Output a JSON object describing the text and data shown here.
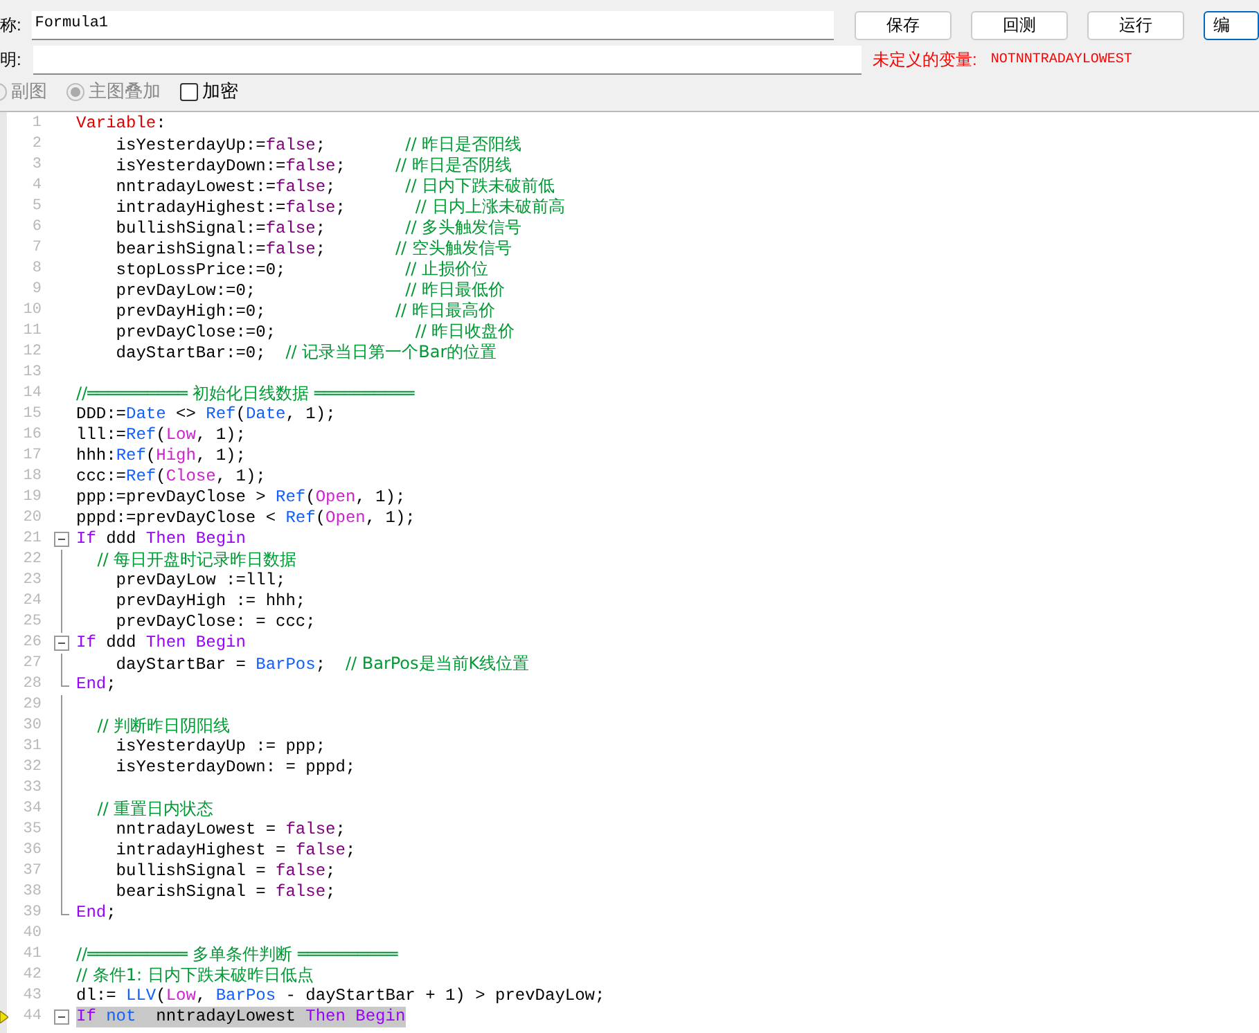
{
  "form": {
    "name_label": "称:",
    "name_value": "Formula1",
    "desc_label": "明:",
    "buttons": [
      "保存",
      "回测",
      "运行",
      "编"
    ],
    "error_label": "未定义的变量:",
    "error_value": "NOTNNTRADAYLOWEST",
    "options": [
      {
        "kind": "radio",
        "label": "副图",
        "selected": false,
        "disabled": true
      },
      {
        "kind": "radio",
        "label": "主图叠加",
        "selected": true,
        "disabled": true
      },
      {
        "kind": "checkbox",
        "label": "加密",
        "checked": false,
        "disabled": false
      }
    ]
  },
  "editor": {
    "lines": [
      {
        "number": "1",
        "kind": "plain",
        "highlighted": false,
        "segments": [
          {
            "kind": "declare",
            "text": "Variable"
          },
          {
            "kind": "plain",
            "text": ":"
          }
        ]
      },
      {
        "number": "2",
        "kind": "plain",
        "highlighted": false,
        "segments": [
          {
            "kind": "plain",
            "text": "    isYesterdayUp:="
          },
          {
            "kind": "bool",
            "text": "false"
          },
          {
            "kind": "plain",
            "text": ";        "
          },
          {
            "kind": "comment",
            "text": "// 昨日是否阳线"
          }
        ]
      },
      {
        "number": "3",
        "kind": "plain",
        "highlighted": false,
        "segments": [
          {
            "kind": "plain",
            "text": "    isYesterdayDown:="
          },
          {
            "kind": "bool",
            "text": "false"
          },
          {
            "kind": "plain",
            "text": ";     "
          },
          {
            "kind": "comment",
            "text": "// 昨日是否阴线"
          }
        ]
      },
      {
        "number": "4",
        "kind": "plain",
        "highlighted": false,
        "segments": [
          {
            "kind": "plain",
            "text": "    nntradayLowest:="
          },
          {
            "kind": "bool",
            "text": "false"
          },
          {
            "kind": "plain",
            "text": ";       "
          },
          {
            "kind": "comment",
            "text": "// 日内下跌未破前低"
          }
        ]
      },
      {
        "number": "5",
        "kind": "plain",
        "highlighted": false,
        "segments": [
          {
            "kind": "plain",
            "text": "    intradayHighest:="
          },
          {
            "kind": "bool",
            "text": "false"
          },
          {
            "kind": "plain",
            "text": ";       "
          },
          {
            "kind": "comment",
            "text": "// 日内上涨未破前高"
          }
        ]
      },
      {
        "number": "6",
        "kind": "plain",
        "highlighted": false,
        "segments": [
          {
            "kind": "plain",
            "text": "    bullishSignal:="
          },
          {
            "kind": "bool",
            "text": "false"
          },
          {
            "kind": "plain",
            "text": ";        "
          },
          {
            "kind": "comment",
            "text": "// 多头触发信号"
          }
        ]
      },
      {
        "number": "7",
        "kind": "plain",
        "highlighted": false,
        "segments": [
          {
            "kind": "plain",
            "text": "    bearishSignal:="
          },
          {
            "kind": "bool",
            "text": "false"
          },
          {
            "kind": "plain",
            "text": ";       "
          },
          {
            "kind": "comment",
            "text": "// 空头触发信号"
          }
        ]
      },
      {
        "number": "8",
        "kind": "plain",
        "highlighted": false,
        "segments": [
          {
            "kind": "plain",
            "text": "    stopLossPrice:=0;            "
          },
          {
            "kind": "comment",
            "text": "// 止损价位"
          }
        ]
      },
      {
        "number": "9",
        "kind": "plain",
        "highlighted": false,
        "segments": [
          {
            "kind": "plain",
            "text": "    prevDayLow:=0;               "
          },
          {
            "kind": "comment",
            "text": "// 昨日最低价"
          }
        ]
      },
      {
        "number": "10",
        "kind": "plain",
        "highlighted": false,
        "segments": [
          {
            "kind": "plain",
            "text": "    prevDayHigh:=0;             "
          },
          {
            "kind": "comment",
            "text": "// 昨日最高价"
          }
        ]
      },
      {
        "number": "11",
        "kind": "plain",
        "highlighted": false,
        "segments": [
          {
            "kind": "plain",
            "text": "    prevDayClose:=0;              "
          },
          {
            "kind": "comment",
            "text": "// 昨日收盘价"
          }
        ]
      },
      {
        "number": "12",
        "kind": "plain",
        "highlighted": false,
        "segments": [
          {
            "kind": "plain",
            "text": "    dayStartBar:=0;  "
          },
          {
            "kind": "comment",
            "text": "// 记录当日第一个Bar的位置"
          }
        ]
      },
      {
        "number": "13",
        "kind": "plain",
        "highlighted": false
      },
      {
        "number": "14",
        "kind": "plain",
        "highlighted": false,
        "segments": [
          {
            "kind": "comment",
            "text": "//══════════ 初始化日线数据 ══════════"
          }
        ]
      },
      {
        "number": "15",
        "kind": "plain",
        "highlighted": false,
        "segments": [
          {
            "kind": "plain",
            "text": "DDD:="
          },
          {
            "kind": "func",
            "text": "Date"
          },
          {
            "kind": "plain",
            "text": " <> "
          },
          {
            "kind": "func",
            "text": "Ref"
          },
          {
            "kind": "plain",
            "text": "("
          },
          {
            "kind": "func",
            "text": "Date"
          },
          {
            "kind": "plain",
            "text": ", 1);"
          }
        ]
      },
      {
        "number": "16",
        "kind": "plain",
        "highlighted": false,
        "segments": [
          {
            "kind": "plain",
            "text": "lll:="
          },
          {
            "kind": "func",
            "text": "Ref"
          },
          {
            "kind": "plain",
            "text": "("
          },
          {
            "kind": "series",
            "text": "Low"
          },
          {
            "kind": "plain",
            "text": ", 1);"
          }
        ]
      },
      {
        "number": "17",
        "kind": "plain",
        "highlighted": false,
        "segments": [
          {
            "kind": "plain",
            "text": "hhh:"
          },
          {
            "kind": "func",
            "text": "Ref"
          },
          {
            "kind": "plain",
            "text": "("
          },
          {
            "kind": "series",
            "text": "High"
          },
          {
            "kind": "plain",
            "text": ", 1);"
          }
        ]
      },
      {
        "number": "18",
        "kind": "plain",
        "highlighted": false,
        "segments": [
          {
            "kind": "plain",
            "text": "ccc:="
          },
          {
            "kind": "func",
            "text": "Ref"
          },
          {
            "kind": "plain",
            "text": "("
          },
          {
            "kind": "series",
            "text": "Close"
          },
          {
            "kind": "plain",
            "text": ", 1);"
          }
        ]
      },
      {
        "number": "19",
        "kind": "plain",
        "highlighted": false,
        "segments": [
          {
            "kind": "plain",
            "text": "ppp:=prevDayClose > "
          },
          {
            "kind": "func",
            "text": "Ref"
          },
          {
            "kind": "plain",
            "text": "("
          },
          {
            "kind": "series",
            "text": "Open"
          },
          {
            "kind": "plain",
            "text": ", 1);"
          }
        ]
      },
      {
        "number": "20",
        "kind": "plain",
        "highlighted": false,
        "segments": [
          {
            "kind": "plain",
            "text": "pppd:=prevDayClose < "
          },
          {
            "kind": "func",
            "text": "Ref"
          },
          {
            "kind": "plain",
            "text": "("
          },
          {
            "kind": "series",
            "text": "Open"
          },
          {
            "kind": "plain",
            "text": ", 1);"
          }
        ]
      },
      {
        "number": "21",
        "kind": "open",
        "highlighted": false,
        "segments": [
          {
            "kind": "control",
            "text": "If"
          },
          {
            "kind": "plain",
            "text": " ddd "
          },
          {
            "kind": "control",
            "text": "Then Begin"
          }
        ]
      },
      {
        "number": "22",
        "kind": "body",
        "highlighted": false,
        "segments": [
          {
            "kind": "comment",
            "text": "    // 每日开盘时记录昨日数据"
          }
        ]
      },
      {
        "number": "23",
        "kind": "body",
        "highlighted": false,
        "segments": [
          {
            "kind": "plain",
            "text": "    prevDayLow :=lll;"
          }
        ]
      },
      {
        "number": "24",
        "kind": "body",
        "highlighted": false,
        "segments": [
          {
            "kind": "plain",
            "text": "    prevDayHigh := hhh;"
          }
        ]
      },
      {
        "number": "25",
        "kind": "body",
        "highlighted": false,
        "segments": [
          {
            "kind": "plain",
            "text": "    prevDayClose: = ccc;"
          }
        ]
      },
      {
        "number": "26",
        "kind": "open",
        "highlighted": false,
        "segments": [
          {
            "kind": "control",
            "text": "If"
          },
          {
            "kind": "plain",
            "text": " ddd "
          },
          {
            "kind": "control",
            "text": "Then Begin"
          }
        ]
      },
      {
        "number": "27",
        "kind": "body",
        "highlighted": false,
        "segments": [
          {
            "kind": "plain",
            "text": "    dayStartBar = "
          },
          {
            "kind": "func",
            "text": "BarPos"
          },
          {
            "kind": "plain",
            "text": ";  "
          },
          {
            "kind": "comment",
            "text": "// BarPos是当前K线位置"
          }
        ]
      },
      {
        "number": "28",
        "kind": "close",
        "highlighted": false,
        "segments": [
          {
            "kind": "control",
            "text": "End"
          },
          {
            "kind": "plain",
            "text": ";"
          }
        ]
      },
      {
        "number": "29",
        "kind": "body",
        "highlighted": false
      },
      {
        "number": "30",
        "kind": "body",
        "highlighted": false,
        "segments": [
          {
            "kind": "comment",
            "text": "    // 判断昨日阴阳线"
          }
        ]
      },
      {
        "number": "31",
        "kind": "body",
        "highlighted": false,
        "segments": [
          {
            "kind": "plain",
            "text": "    isYesterdayUp := ppp;"
          }
        ]
      },
      {
        "number": "32",
        "kind": "body",
        "highlighted": false,
        "segments": [
          {
            "kind": "plain",
            "text": "    isYesterdayDown: = pppd;"
          }
        ]
      },
      {
        "number": "33",
        "kind": "body",
        "highlighted": false
      },
      {
        "number": "34",
        "kind": "body",
        "highlighted": false,
        "segments": [
          {
            "kind": "comment",
            "text": "    // 重置日内状态"
          }
        ]
      },
      {
        "number": "35",
        "kind": "body",
        "highlighted": false,
        "segments": [
          {
            "kind": "plain",
            "text": "    nntradayLowest = "
          },
          {
            "kind": "bool",
            "text": "false"
          },
          {
            "kind": "plain",
            "text": ";"
          }
        ]
      },
      {
        "number": "36",
        "kind": "body",
        "highlighted": false,
        "segments": [
          {
            "kind": "plain",
            "text": "    intradayHighest = "
          },
          {
            "kind": "bool",
            "text": "false"
          },
          {
            "kind": "plain",
            "text": ";"
          }
        ]
      },
      {
        "number": "37",
        "kind": "body",
        "highlighted": false,
        "segments": [
          {
            "kind": "plain",
            "text": "    bullishSignal = "
          },
          {
            "kind": "bool",
            "text": "false"
          },
          {
            "kind": "plain",
            "text": ";"
          }
        ]
      },
      {
        "number": "38",
        "kind": "body",
        "highlighted": false,
        "segments": [
          {
            "kind": "plain",
            "text": "    bearishSignal = "
          },
          {
            "kind": "bool",
            "text": "false"
          },
          {
            "kind": "plain",
            "text": ";"
          }
        ]
      },
      {
        "number": "39",
        "kind": "close",
        "highlighted": false,
        "segments": [
          {
            "kind": "control",
            "text": "End"
          },
          {
            "kind": "plain",
            "text": ";"
          }
        ]
      },
      {
        "number": "40",
        "kind": "plain",
        "highlighted": false
      },
      {
        "number": "41",
        "kind": "plain",
        "highlighted": false,
        "segments": [
          {
            "kind": "comment",
            "text": "//══════════ 多单条件判断 ══════════"
          }
        ]
      },
      {
        "number": "42",
        "kind": "plain",
        "highlighted": false,
        "segments": [
          {
            "kind": "comment",
            "text": "// 条件1: 日内下跌未破昨日低点"
          }
        ]
      },
      {
        "number": "43",
        "kind": "plain",
        "highlighted": false,
        "segments": [
          {
            "kind": "plain",
            "text": "dl:= "
          },
          {
            "kind": "func",
            "text": "LLV"
          },
          {
            "kind": "plain",
            "text": "("
          },
          {
            "kind": "series",
            "text": "Low"
          },
          {
            "kind": "plain",
            "text": ", "
          },
          {
            "kind": "func",
            "text": "BarPos"
          },
          {
            "kind": "plain",
            "text": " - dayStartBar + 1) > prevDayLow;"
          }
        ]
      },
      {
        "number": "44",
        "kind": "open",
        "highlighted": true,
        "segments": [
          {
            "kind": "control",
            "text": "If "
          },
          {
            "kind": "func",
            "text": "not"
          },
          {
            "kind": "plain",
            "text": "  nntradayLowest "
          },
          {
            "kind": "control",
            "text": "Then Begin"
          }
        ]
      }
    ]
  }
}
